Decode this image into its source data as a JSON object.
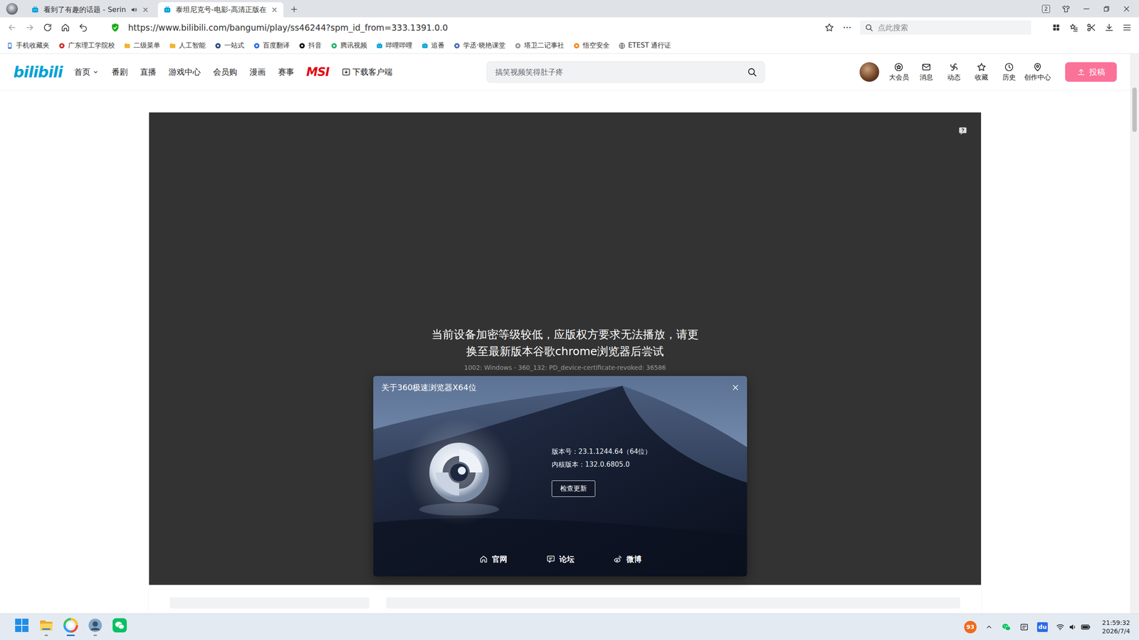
{
  "tabs": [
    {
      "label": "看到了有趣的话题 - Serin",
      "selected": false
    },
    {
      "label": "泰坦尼克号-电影-高清正版在",
      "selected": true
    }
  ],
  "tab_count": "2",
  "address": {
    "url": "https://www.bilibili.com/bangumi/play/ss46244?spm_id_from=333.1391.0.0"
  },
  "side_search": {
    "placeholder": "点此搜索"
  },
  "bookmarks": [
    {
      "label": "手机收藏夹",
      "kind": "phone",
      "color": "#3a7bd5"
    },
    {
      "label": "广东理工学院校",
      "kind": "site",
      "color": "#d0312d"
    },
    {
      "label": "二级菜单",
      "kind": "folder",
      "color": "#f0b530"
    },
    {
      "label": "人工智能",
      "kind": "folder",
      "color": "#f0b530"
    },
    {
      "label": "一站式",
      "kind": "site",
      "color": "#2c4a7a"
    },
    {
      "label": "百度翻译",
      "kind": "site",
      "color": "#2e6be6"
    },
    {
      "label": "抖音",
      "kind": "site",
      "color": "#111111"
    },
    {
      "label": "腾讯视频",
      "kind": "site",
      "color": "#21b36b"
    },
    {
      "label": "哔哩哔哩",
      "kind": "tv",
      "color": "#00a1d6"
    },
    {
      "label": "追番",
      "kind": "tv",
      "color": "#00a1d6"
    },
    {
      "label": "学丞·晓艳课堂",
      "kind": "site",
      "color": "#4b6cb7"
    },
    {
      "label": "塔卫二记事社",
      "kind": "site",
      "color": "#999999"
    },
    {
      "label": "悟空安全",
      "kind": "site",
      "color": "#f08a24"
    },
    {
      "label": "ETEST 通行证",
      "kind": "globe",
      "color": "#555555"
    }
  ],
  "site": {
    "logo": "bilibili",
    "nav": [
      {
        "label": "首页",
        "kind": "dropdown"
      },
      {
        "label": "番剧",
        "kind": "link"
      },
      {
        "label": "直播",
        "kind": "link"
      },
      {
        "label": "游戏中心",
        "kind": "link"
      },
      {
        "label": "会员购",
        "kind": "link"
      },
      {
        "label": "漫画",
        "kind": "link"
      },
      {
        "label": "赛事",
        "kind": "link"
      },
      {
        "label": "MSI",
        "kind": "logo"
      },
      {
        "label": "下载客户端",
        "kind": "download"
      }
    ],
    "search": {
      "placeholder": "搞笑视频笑得肚子疼"
    },
    "user_menu": [
      {
        "label": "大会员",
        "kind": "vip"
      },
      {
        "label": "消息",
        "kind": "message"
      },
      {
        "label": "动态",
        "kind": "dynamic"
      },
      {
        "label": "收藏",
        "kind": "favorite"
      },
      {
        "label": "历史",
        "kind": "history"
      },
      {
        "label": "创作中心",
        "kind": "creator"
      }
    ],
    "upload": "投稿"
  },
  "player": {
    "message": "当前设备加密等级较低，应版权方要求无法播放，请更换至最新版本谷歌chrome浏览器后尝试",
    "code": "1002: Windows - 360_132: PD_device-certificate-revoked: 36586"
  },
  "dialog": {
    "title": "关于360极速浏览器X64位",
    "version": "版本号：23.1.1244.64（64位）",
    "core": "内核版本：132.0.6805.0",
    "button": "检查更新",
    "links": [
      {
        "label": "官网",
        "kind": "home"
      },
      {
        "label": "论坛",
        "kind": "forum"
      },
      {
        "label": "微博",
        "kind": "weibo"
      }
    ]
  },
  "taskbar": {
    "apps": [
      {
        "kind": "windows",
        "running": false,
        "selected": false
      },
      {
        "kind": "explorer",
        "running": true,
        "selected": false
      },
      {
        "kind": "browser360",
        "running": true,
        "selected": true
      },
      {
        "kind": "app",
        "running": true,
        "selected": false
      },
      {
        "kind": "wechat",
        "running": false,
        "selected": false
      }
    ],
    "badge": "93",
    "ime": "du",
    "time": "21:59:32",
    "date": "2026/7/4"
  }
}
